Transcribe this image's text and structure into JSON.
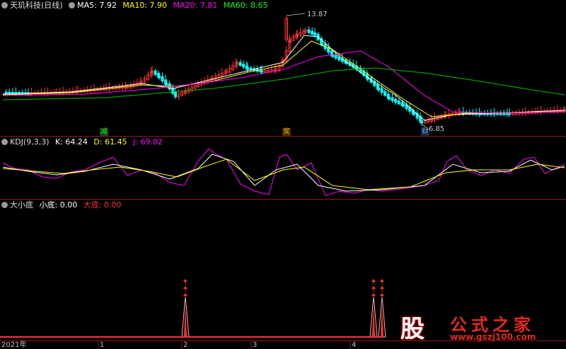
{
  "main_pane": {
    "stock_name": "天玑科技(日线)",
    "ma5": {
      "label": "MA5:",
      "value": "7.92",
      "color": "#ffffff"
    },
    "ma10": {
      "label": "MA10:",
      "value": "7.90",
      "color": "#ffff00"
    },
    "ma20": {
      "label": "MA20:",
      "value": "7.81",
      "color": "#ff00ff"
    },
    "ma60": {
      "label": "MA60:",
      "value": "8.65",
      "color": "#00ff00"
    },
    "high_label": "13.87",
    "low_label": "6.85",
    "tag_jian": "减",
    "tag_jiang": "奖",
    "tag_cai": "财"
  },
  "kdj_pane": {
    "name": "KDJ(9,3,3)",
    "k": {
      "label": "K:",
      "value": "64.24",
      "color": "#ffffff"
    },
    "d": {
      "label": "D:",
      "value": "61.45",
      "color": "#ffff00"
    },
    "j": {
      "label": "J:",
      "value": "69.82",
      "color": "#ff00ff"
    }
  },
  "indicator_pane": {
    "name": "大小底",
    "small": {
      "label": "小底:",
      "value": "0.00",
      "color": "#ffffff"
    },
    "big": {
      "label": "大底:",
      "value": "0.00",
      "color": "#ff3030"
    }
  },
  "x_axis": {
    "year": "2021年",
    "months": [
      "1",
      "2",
      "3",
      "4"
    ]
  },
  "watermark": {
    "gu": "股",
    "title": "公式之家",
    "url": "www.gszj100.com"
  },
  "colors": {
    "up": "#ff3232",
    "down": "#00ffff",
    "grid": "#8b1a1a",
    "ma60": "#00c000"
  }
}
